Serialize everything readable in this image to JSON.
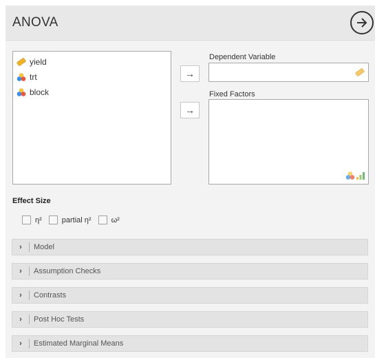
{
  "header": {
    "title": "ANOVA",
    "run_icon": "arrow-circle-right-icon"
  },
  "variables": [
    {
      "name": "yield",
      "icon": "ruler-continuous-icon"
    },
    {
      "name": "trt",
      "icon": "nominal-circles-icon"
    },
    {
      "name": "block",
      "icon": "nominal-circles-icon"
    }
  ],
  "dependent": {
    "label": "Dependent Variable",
    "value": "",
    "type_icon": "ruler-continuous-icon"
  },
  "fixed": {
    "label": "Fixed Factors",
    "type_icons": [
      "nominal-circles-icon",
      "ordinal-bars-icon"
    ]
  },
  "arrows": {
    "dependent": "→",
    "fixed": "→"
  },
  "effect_size": {
    "title": "Effect Size",
    "options": [
      {
        "label": "η²",
        "checked": false
      },
      {
        "label": "partial η²",
        "checked": false
      },
      {
        "label": "ω²",
        "checked": false
      }
    ]
  },
  "sections": [
    {
      "label": "Model"
    },
    {
      "label": "Assumption Checks"
    },
    {
      "label": "Contrasts"
    },
    {
      "label": "Post Hoc Tests"
    },
    {
      "label": "Estimated Marginal Means"
    }
  ],
  "chevron": "›",
  "colors": {
    "continuous": "#f0b429",
    "nominal_red": "#e8573a",
    "nominal_blue": "#3d8ee3",
    "nominal_yellow": "#f5c242",
    "header_bg": "#e8e8e8",
    "panel_bg": "#f3f3f3"
  }
}
